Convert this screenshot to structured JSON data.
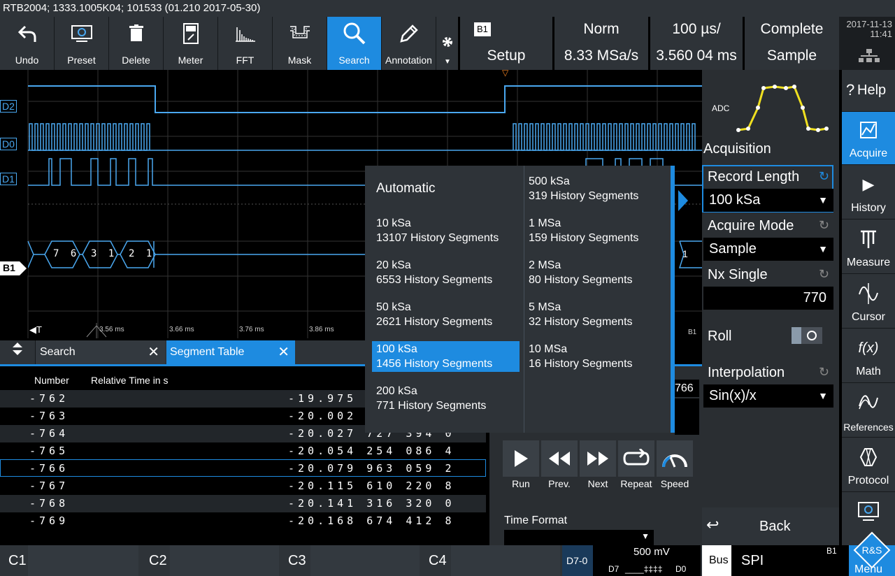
{
  "title": "RTB2004; 1333.1005K04; 101533 (01.210 2017-05-30)",
  "toolbar": {
    "undo": "Undo",
    "preset": "Preset",
    "delete": "Delete",
    "meter": "Meter",
    "fft": "FFT",
    "mask": "Mask",
    "search": "Search",
    "annotation": "Annotation"
  },
  "status": {
    "badge": "B1",
    "trigger_mode": "Norm",
    "timebase": "100 µs/",
    "acq_state": "Complete",
    "setup": "Setup",
    "sample_rate": "8.33 MSa/s",
    "time_pos": "3.560 04 ms",
    "acq_mode": "Sample"
  },
  "datetime": {
    "date": "2017-11-13",
    "time": "11:41"
  },
  "scope": {
    "channels": [
      "D2",
      "D0",
      "D1",
      "B1"
    ],
    "time_ticks": [
      "3.56 ms",
      "3.66 ms",
      "3.76 ms",
      "3.86 ms"
    ],
    "bus_values": [
      "7 6",
      "3 1",
      "2 1"
    ],
    "bus_right": "1",
    "bus_end_tag": "B1",
    "trigger_marker": "▽",
    "trig_label": "◀T"
  },
  "tabs": {
    "search": "Search",
    "segment_table": "Segment Table"
  },
  "table": {
    "headers": [
      "Number",
      "Relative Time in s"
    ],
    "rows": [
      {
        "num": "-762",
        "time": "-19.975"
      },
      {
        "num": "-763",
        "time": "-20.002"
      },
      {
        "num": "-764",
        "time": "-20.027 727 394 0"
      },
      {
        "num": "-765",
        "time": "-20.054 254 086 4"
      },
      {
        "num": "-766",
        "time": "-20.079 963 059 2"
      },
      {
        "num": "-767",
        "time": "-20.115 610 220 8"
      },
      {
        "num": "-768",
        "time": "-20.141 316 320 0"
      },
      {
        "num": "-769",
        "time": "-20.168 674 412 8"
      }
    ],
    "partial_right": "766"
  },
  "popup": {
    "automatic": "Automatic",
    "left": [
      {
        "size": "10 kSa",
        "seg": "13107 History Segments"
      },
      {
        "size": "20 kSa",
        "seg": "6553 History Segments"
      },
      {
        "size": "50 kSa",
        "seg": "2621 History Segments"
      },
      {
        "size": "100 kSa",
        "seg": "1456 History Segments"
      },
      {
        "size": "200 kSa",
        "seg": "771 History Segments"
      }
    ],
    "right": [
      {
        "size": "500 kSa",
        "seg": "319 History Segments"
      },
      {
        "size": "1 MSa",
        "seg": "159 History Segments"
      },
      {
        "size": "2 MSa",
        "seg": "80 History Segments"
      },
      {
        "size": "5 MSa",
        "seg": "32 History Segments"
      },
      {
        "size": "10 MSa",
        "seg": "16 History Segments"
      }
    ]
  },
  "playback": {
    "run": "Run",
    "prev": "Prev.",
    "next": "Next",
    "repeat": "Repeat",
    "speed": "Speed"
  },
  "time_format": "Time Format",
  "panel": {
    "adc": "ADC",
    "acquisition": "Acquisition",
    "record_length_label": "Record Length",
    "record_length_value": "100 kSa",
    "acquire_mode_label": "Acquire Mode",
    "acquire_mode_value": "Sample",
    "nx_single_label": "Nx Single",
    "nx_single_value": "770",
    "roll_label": "Roll",
    "interp_label": "Interpolation",
    "interp_value": "Sin(x)/x",
    "back": "Back"
  },
  "sidebar": {
    "help": "Help",
    "acquire": "Acquire",
    "history": "History",
    "measure": "Measure",
    "cursor": "Cursor",
    "math": "Math",
    "math_icon": "f(x)",
    "references": "References",
    "protocol": "Protocol",
    "menu": "Menu"
  },
  "channels_bar": {
    "c1": "C1",
    "c2": "C2",
    "c3": "C3",
    "c4": "C4",
    "digital": "D7-0",
    "volt": "500 mV",
    "d7": "D7",
    "pattern": "____‡‡‡‡",
    "d0": "D0",
    "bus": "Bus",
    "spi": "SPI",
    "b1": "B1"
  },
  "colors": {
    "accent": "#1e8be0",
    "panel": "#2e3338",
    "trace": "#4aa8f0",
    "yellow": "#f0e020"
  }
}
